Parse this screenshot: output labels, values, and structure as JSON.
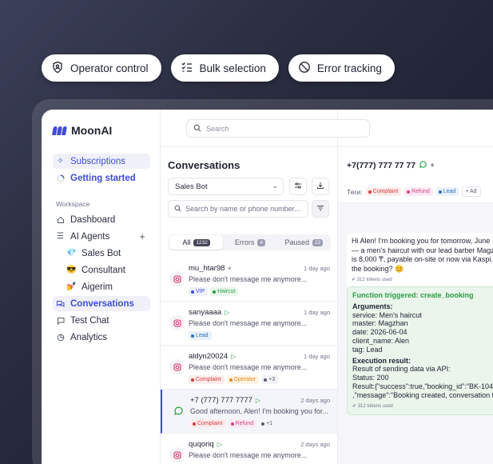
{
  "pills": [
    {
      "label": "Operator control",
      "icon": "shield-user-icon"
    },
    {
      "label": "Bulk selection",
      "icon": "checklist-icon"
    },
    {
      "label": "Error tracking",
      "icon": "no-entry-icon"
    }
  ],
  "app": {
    "brand": "MoonAI",
    "search_placeholder": "Search",
    "sidebar": {
      "subscriptions": "Subscriptions",
      "getting_started": "Getting started",
      "section": "Workspace",
      "items": {
        "dashboard": "Dashboard",
        "ai_agents": "AI Agents",
        "sales_bot": "Sales Bot",
        "consultant": "Consultant",
        "aigerim": "Aigerim",
        "conversations": "Conversations",
        "test_chat": "Test Chat",
        "analytics": "Analytics"
      }
    },
    "conversations": {
      "title": "Conversations",
      "bot_select": "Sales Bot",
      "filter_placeholder": "Search by name or phone number...",
      "tabs": [
        {
          "label": "All",
          "count": "1232"
        },
        {
          "label": "Errors",
          "count": "4"
        },
        {
          "label": "Paused",
          "count": "22"
        }
      ],
      "rows": [
        {
          "name": "mu_htar98",
          "time": "1 day ago",
          "msg": "Please don't message me anymore...",
          "tags": [
            {
              "t": "VIP",
              "c": "vip"
            },
            {
              "t": "Haircut",
              "c": "hair"
            }
          ]
        },
        {
          "name": "sanyaaaa",
          "time": "1 day ago",
          "msg": "Please don't message me anymore...",
          "tags": [
            {
              "t": "Lead",
              "c": "lead"
            }
          ]
        },
        {
          "name": "aldyn20024",
          "time": "1 day ago",
          "msg": "Please don't message me anymore...",
          "tags": [
            {
              "t": "Complaint",
              "c": "comp"
            },
            {
              "t": "Operator",
              "c": "op"
            },
            {
              "t": "+3",
              "c": "more"
            }
          ]
        },
        {
          "name": "+7 (777) 777 7777",
          "time": "2 days ago",
          "msg": "Good afternoon, Alen! I'm booking you for...",
          "tags": [
            {
              "t": "Complaint",
              "c": "comp"
            },
            {
              "t": "Refund",
              "c": "ref"
            },
            {
              "t": "+1",
              "c": "more"
            }
          ]
        },
        {
          "name": "quqoriq",
          "time": "2 days ago",
          "msg": "Please don't message me anymore...",
          "tags": []
        }
      ]
    },
    "chat": {
      "phone": "+7(777) 777 77 77",
      "tags_label": "Теги:",
      "tags": [
        {
          "t": "Complaint",
          "c": "comp"
        },
        {
          "t": "Refund",
          "c": "ref"
        },
        {
          "t": "Lead",
          "c": "lead"
        }
      ],
      "add_tag": "+ Ad",
      "message_lines": [
        "Hi Alen! I'm booking you for tomorrow, June",
        "— a men's haircut with our lead barber Magzh",
        "is 8,000 ₸, payable on-site or now via Kaspi.",
        "the booking? 😊"
      ],
      "message_tokens": "312 tokens used",
      "function": {
        "title": "Function triggered: create_booking",
        "args_label": "Arguments:",
        "args": [
          "service: Men's haircut",
          "master: Magzhan",
          "date: 2026-06-04",
          "client_name: Alen",
          "tag: Lead"
        ],
        "result_label": "Execution result:",
        "result": [
          "Result of sending data via API:",
          "Status: 200",
          "Result:{\"success\":true,\"booking_id\":\"BK-104",
          ",\"message\":\"Booking created, conversation t"
        ],
        "tokens": "312 tokens used"
      }
    }
  }
}
